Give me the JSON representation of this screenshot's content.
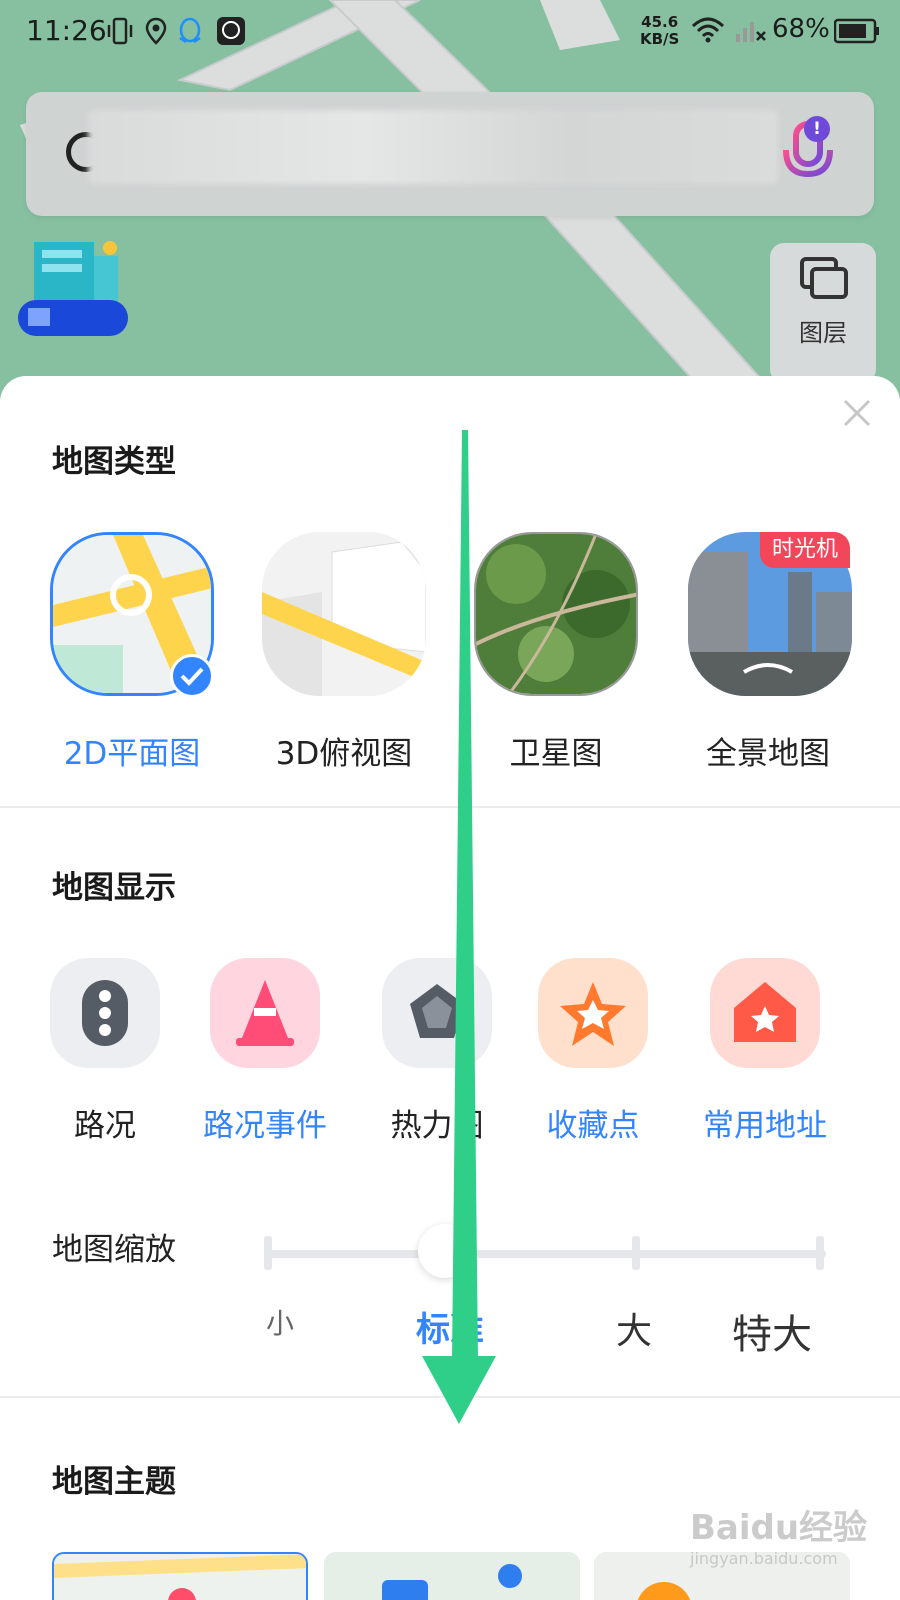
{
  "status_bar": {
    "time": "11:26",
    "net_speed_value": "45.6",
    "net_speed_unit": "KB/S",
    "battery": "68%"
  },
  "search": {
    "voice_badge": "!"
  },
  "side": {
    "layer_label": "图层"
  },
  "sheet": {
    "map_type": {
      "title": "地图类型",
      "items": [
        {
          "label": "2D平面图",
          "selected": true
        },
        {
          "label": "3D俯视图",
          "selected": false
        },
        {
          "label": "卫星图",
          "selected": false
        },
        {
          "label": "全景地图",
          "selected": false,
          "tag": "时光机"
        }
      ]
    },
    "map_display": {
      "title": "地图显示",
      "items": [
        {
          "label": "路况",
          "active": false,
          "icon": "traffic-light-icon"
        },
        {
          "label": "路况事件",
          "active": true,
          "icon": "traffic-cone-icon"
        },
        {
          "label": "热力图",
          "active": false,
          "icon": "heatmap-pentagon-icon"
        },
        {
          "label": "收藏点",
          "active": true,
          "icon": "favorite-star-icon"
        },
        {
          "label": "常用地址",
          "active": true,
          "icon": "home-star-icon"
        }
      ]
    },
    "map_zoom": {
      "title": "地图缩放",
      "options": [
        "小",
        "标准",
        "大",
        "特大"
      ],
      "selected": "标准"
    },
    "map_theme": {
      "title": "地图主题"
    }
  },
  "watermark": {
    "brand": "Baidu经验",
    "url": "jingyan.baidu.com"
  },
  "colors": {
    "accent": "#3385ff",
    "arrow": "#2fcf8a",
    "map_green": "#87c0a0"
  }
}
